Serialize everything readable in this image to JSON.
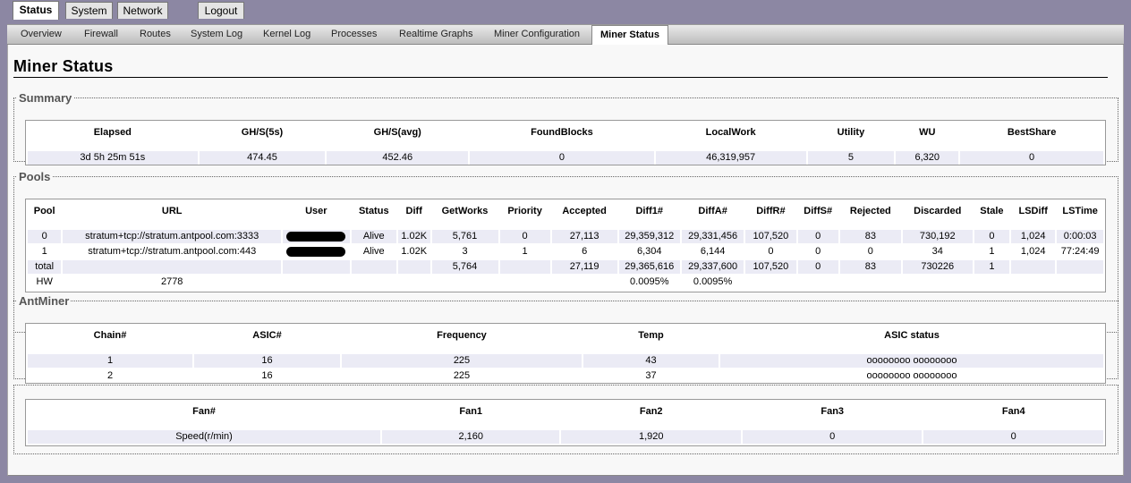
{
  "top_tabs": [
    {
      "label": "Status",
      "active": true
    },
    {
      "label": "System"
    },
    {
      "label": "Network"
    },
    {
      "label": "Logout"
    }
  ],
  "sub_tabs": [
    {
      "label": "Overview"
    },
    {
      "label": "Firewall"
    },
    {
      "label": "Routes"
    },
    {
      "label": "System Log"
    },
    {
      "label": "Kernel Log"
    },
    {
      "label": "Processes"
    },
    {
      "label": "Realtime Graphs"
    },
    {
      "label": "Miner Configuration"
    },
    {
      "label": "Miner Status",
      "active": true
    }
  ],
  "page_title": "Miner Status",
  "summary": {
    "legend": "Summary",
    "headers": [
      "Elapsed",
      "GH/S(5s)",
      "GH/S(avg)",
      "FoundBlocks",
      "LocalWork",
      "Utility",
      "WU",
      "BestShare"
    ],
    "row": [
      "3d 5h 25m 51s",
      "474.45",
      "452.46",
      "0",
      "46,319,957",
      "5",
      "6,320",
      "0"
    ]
  },
  "pools": {
    "legend": "Pools",
    "headers": [
      "Pool",
      "URL",
      "User",
      "Status",
      "Diff",
      "GetWorks",
      "Priority",
      "Accepted",
      "Diff1#",
      "DiffA#",
      "DiffR#",
      "DiffS#",
      "Rejected",
      "Discarded",
      "Stale",
      "LSDiff",
      "LSTime"
    ],
    "rows": [
      [
        "0",
        "stratum+tcp://stratum.antpool.com:3333",
        "",
        "Alive",
        "1.02K",
        "5,761",
        "0",
        "27,113",
        "29,359,312",
        "29,331,456",
        "107,520",
        "0",
        "83",
        "730,192",
        "0",
        "1,024",
        "0:00:03"
      ],
      [
        "1",
        "stratum+tcp://stratum.antpool.com:443",
        "",
        "Alive",
        "1.02K",
        "3",
        "1",
        "6",
        "6,304",
        "6,144",
        "0",
        "0",
        "0",
        "34",
        "1",
        "1,024",
        "77:24:49"
      ],
      [
        "total",
        "",
        "",
        "",
        "",
        "5,764",
        "",
        "27,119",
        "29,365,616",
        "29,337,600",
        "107,520",
        "0",
        "83",
        "730226",
        "1",
        "",
        ""
      ]
    ],
    "hw_label": "HW",
    "hw_value": "2778",
    "hw_pct1": "0.0095%",
    "hw_pct2": "0.0095%"
  },
  "antminer": {
    "legend": "AntMiner",
    "headers": [
      "Chain#",
      "ASIC#",
      "Frequency",
      "Temp",
      "ASIC status"
    ],
    "rows": [
      [
        "1",
        "16",
        "225",
        "43",
        "oooooooo oooooooo"
      ],
      [
        "2",
        "16",
        "225",
        "37",
        "oooooooo oooooooo"
      ]
    ]
  },
  "fans": {
    "headers": [
      "Fan#",
      "Fan1",
      "Fan2",
      "Fan3",
      "Fan4"
    ],
    "row": [
      "Speed(r/min)",
      "2,160",
      "1,920",
      "0",
      "0"
    ]
  }
}
